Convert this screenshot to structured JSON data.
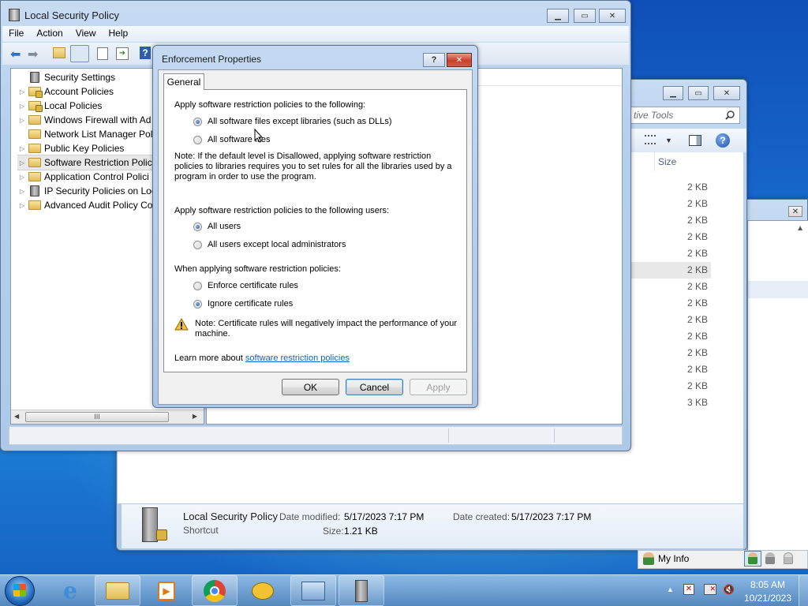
{
  "main_window": {
    "title": "Local Security Policy",
    "menu": [
      "File",
      "Action",
      "View",
      "Help"
    ],
    "tree": [
      {
        "label": "Security Settings",
        "arrow": "",
        "icon": "security-settings-icon"
      },
      {
        "label": "Account Policies",
        "arrow": "▷",
        "icon": "folder-lock-icon"
      },
      {
        "label": "Local Policies",
        "arrow": "▷",
        "icon": "folder-lock-icon"
      },
      {
        "label": "Windows Firewall with Ad",
        "arrow": "▷",
        "icon": "folder-icon"
      },
      {
        "label": "Network List Manager Pol",
        "arrow": "",
        "icon": "folder-icon"
      },
      {
        "label": "Public Key Policies",
        "arrow": "▷",
        "icon": "folder-icon"
      },
      {
        "label": "Software Restriction Polici",
        "arrow": "▷",
        "icon": "folder-icon",
        "selected": true
      },
      {
        "label": "Application Control Polici",
        "arrow": "▷",
        "icon": "folder-icon"
      },
      {
        "label": "IP Security Policies on Loc",
        "arrow": "▷",
        "icon": "ip-security-icon"
      },
      {
        "label": "Advanced Audit Policy Co",
        "arrow": "▷",
        "icon": "folder-icon"
      }
    ],
    "scroll_mark": "III",
    "left_arrow": "◀",
    "right_arrow": "▶"
  },
  "explorer": {
    "search_placeholder": "tive Tools",
    "column_size": "Size",
    "sizes": [
      "2 KB",
      "2 KB",
      "2 KB",
      "2 KB",
      "2 KB",
      "2 KB",
      "2 KB",
      "2 KB",
      "2 KB",
      "2 KB",
      "2 KB",
      "2 KB",
      "2 KB",
      "3 KB"
    ],
    "details": {
      "name": "Local Security Policy",
      "type": "Shortcut",
      "date_modified_label": "Date modified:",
      "date_modified": "5/17/2023 7:17 PM",
      "date_created_label": "Date created:",
      "date_created": "5/17/2023 7:17 PM",
      "size_label": "Size:",
      "size": "1.21 KB"
    }
  },
  "dialog": {
    "title": "Enforcement Properties",
    "help_btn": "?",
    "close_btn": "✕",
    "tab": "General",
    "section1": "Apply software restriction policies to the following:",
    "opt_files_except_libs": "All software files except libraries (such as DLLs)",
    "opt_all_files": "All software files",
    "note1": "Note:  If the default level is Disallowed, applying software restriction policies to libraries requires you to set rules for all the libraries used by a program in order to use the program.",
    "section2": "Apply software restriction policies to the following users:",
    "opt_all_users": "All users",
    "opt_except_admins": "All users except local administrators",
    "section3": "When applying software restriction policies:",
    "opt_enforce_cert": "Enforce certificate rules",
    "opt_ignore_cert": "Ignore certificate rules",
    "note2": "Note:  Certificate rules will negatively impact the performance of your machine.",
    "learn_prefix": "Learn more about ",
    "learn_link": "software restriction policies",
    "ok": "OK",
    "cancel": "Cancel",
    "apply": "Apply"
  },
  "third_window": {
    "close_glyph": "✕",
    "scroll_up": "▲"
  },
  "taskbar": {
    "my_info": "My Info",
    "time": "8:05 AM",
    "date": "10/21/2023",
    "tray_up": "▲"
  }
}
